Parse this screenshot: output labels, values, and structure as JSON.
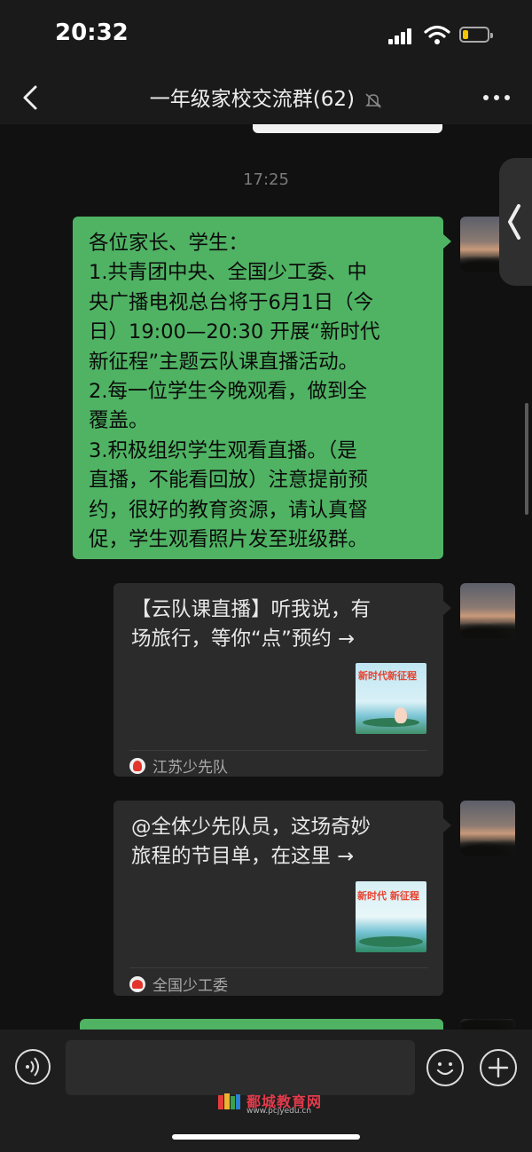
{
  "status_bar": {
    "time": "20:32"
  },
  "header": {
    "title": "一年级家校交流群(62)"
  },
  "chat": {
    "timestamp": "17:25",
    "announcement_lines": [
      "各位家长、学生：",
      "1.共青团中央、全国少工委、中",
      "央广播电视总台将于6月1日（今",
      "日）19:00—20:30 开展“新时代",
      "新征程”主题云队课直播活动。",
      "2.每一位学生今晚观看，做到全",
      "覆盖。",
      "3.积极组织学生观看直播。（是",
      "直播，不能看回放）注意提前预",
      "约，很好的教育资源，请认真督",
      "促，学生观看照片发至班级群。"
    ],
    "cards": [
      {
        "title_lines": [
          "【云队课直播】听我说，有",
          "场旅行，等你“点”预约 →"
        ],
        "thumb_text": "新时代新征程",
        "source": "江苏少先队"
      },
      {
        "title_lines": [
          "@全体少先队员，这场奇妙",
          "旅程的节目单，在这里 →"
        ],
        "thumb_text": "新时代 新征程",
        "source": "全国少工委"
      }
    ]
  },
  "input": {
    "placeholder": ""
  },
  "watermark": {
    "name": "鄱城教育网",
    "url": "www.pcjyedu.cn"
  },
  "colors": {
    "bubble_green": "#4fb363",
    "card_bg": "#2b2b2b",
    "background": "#111111"
  }
}
